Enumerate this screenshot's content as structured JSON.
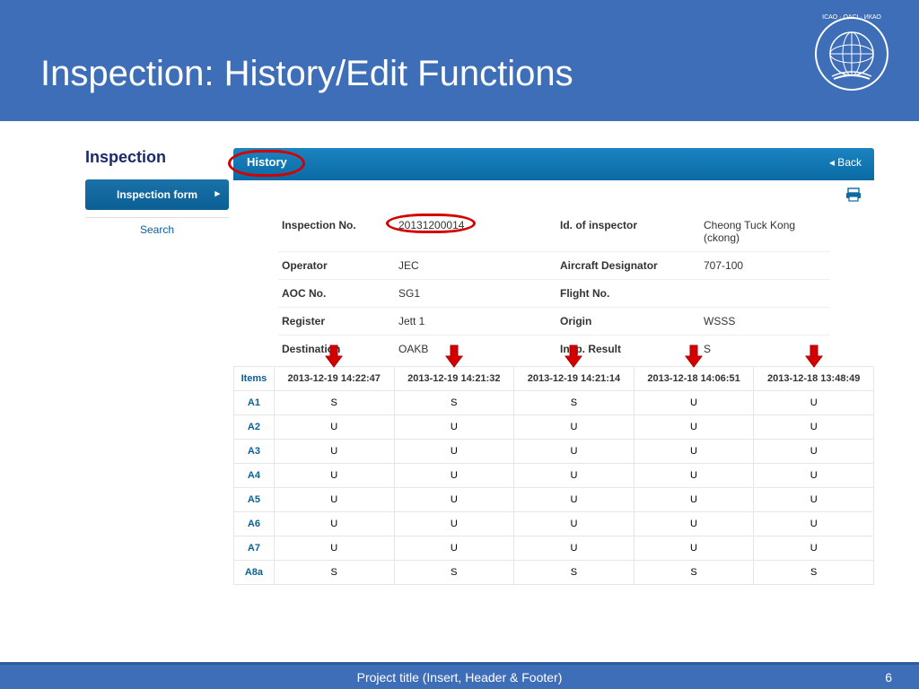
{
  "slide": {
    "title": "Inspection: History/Edit Functions",
    "footer_text": "Project title (Insert, Header & Footer)",
    "page_number": "6"
  },
  "left": {
    "heading": "Inspection",
    "nav_button": "Inspection form",
    "search": "Search"
  },
  "bar": {
    "tab": "History",
    "back": "◂ Back"
  },
  "info": {
    "inspection_no_label": "Inspection No.",
    "inspection_no": "20131200014",
    "inspector_label": "Id. of inspector",
    "inspector": "Cheong Tuck Kong (ckong)",
    "operator_label": "Operator",
    "operator": "JEC",
    "designator_label": "Aircraft Designator",
    "designator": "707-100",
    "aoc_label": "AOC No.",
    "aoc": "SG1",
    "flight_label": "Flight No.",
    "flight": "",
    "register_label": "Register",
    "register": "Jett 1",
    "origin_label": "Origin",
    "origin": "WSSS",
    "destination_label": "Destination",
    "destination": "OAKB",
    "result_label": "Insp. Result",
    "result": "S"
  },
  "table": {
    "items_header": "Items",
    "cols": [
      "2013-12-19 14:22:47",
      "2013-12-19 14:21:32",
      "2013-12-19 14:21:14",
      "2013-12-18 14:06:51",
      "2013-12-18 13:48:49"
    ],
    "rows": [
      {
        "id": "A1",
        "v": [
          "S",
          "S",
          "S",
          "U",
          "U"
        ]
      },
      {
        "id": "A2",
        "v": [
          "U",
          "U",
          "U",
          "U",
          "U"
        ]
      },
      {
        "id": "A3",
        "v": [
          "U",
          "U",
          "U",
          "U",
          "U"
        ]
      },
      {
        "id": "A4",
        "v": [
          "U",
          "U",
          "U",
          "U",
          "U"
        ]
      },
      {
        "id": "A5",
        "v": [
          "U",
          "U",
          "U",
          "U",
          "U"
        ]
      },
      {
        "id": "A6",
        "v": [
          "U",
          "U",
          "U",
          "U",
          "U"
        ]
      },
      {
        "id": "A7",
        "v": [
          "U",
          "U",
          "U",
          "U",
          "U"
        ]
      },
      {
        "id": "A8a",
        "v": [
          "S",
          "S",
          "S",
          "S",
          "S"
        ]
      }
    ]
  }
}
